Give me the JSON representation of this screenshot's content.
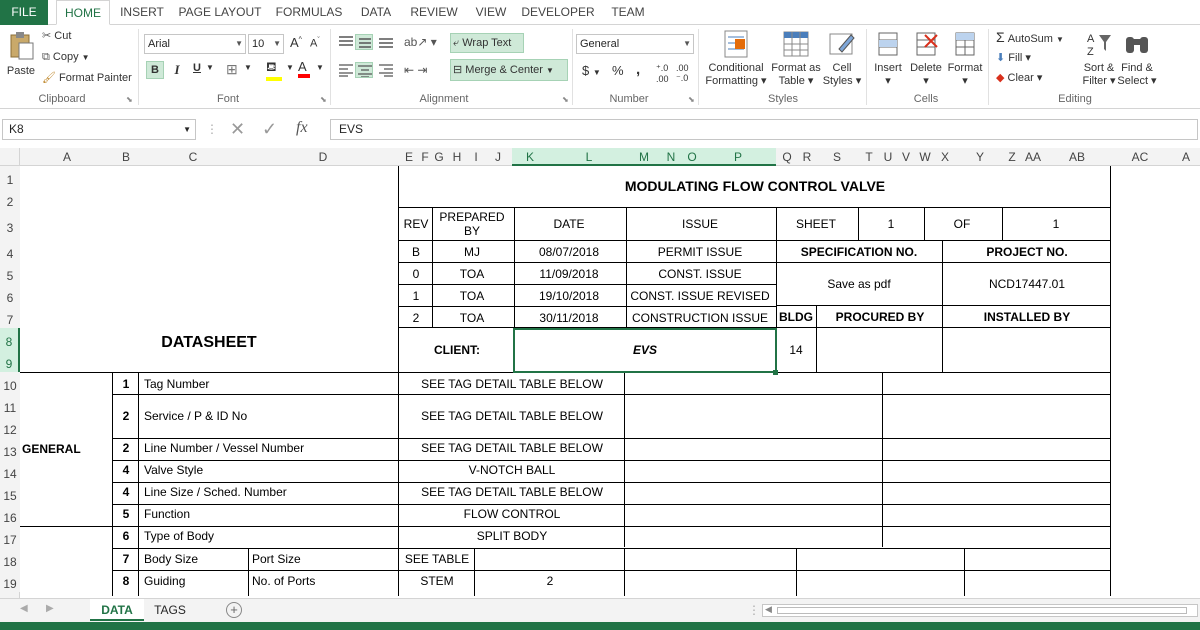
{
  "ribbon_tabs": [
    "FILE",
    "HOME",
    "INSERT",
    "PAGE LAYOUT",
    "FORMULAS",
    "DATA",
    "REVIEW",
    "VIEW",
    "DEVELOPER",
    "TEAM"
  ],
  "clipboard": {
    "paste": "Paste",
    "cut": "Cut",
    "copy": "Copy",
    "format_painter": "Format Painter",
    "group": "Clipboard"
  },
  "font": {
    "name": "Arial",
    "size": "10",
    "bold": "B",
    "italic": "I",
    "underline": "U",
    "group": "Font"
  },
  "alignment": {
    "wrap_text": "Wrap Text",
    "merge_center": "Merge & Center",
    "group": "Alignment"
  },
  "number": {
    "format": "General",
    "currency": "$",
    "percent": "%",
    "comma": ",",
    "group": "Number"
  },
  "styles": {
    "conditional": "Conditional",
    "conditional2": "Formatting",
    "format_as": "Format as",
    "table": "Table",
    "cell": "Cell",
    "cell_styles": "Styles",
    "group": "Styles"
  },
  "cells": {
    "insert": "Insert",
    "delete": "Delete",
    "format": "Format",
    "group": "Cells"
  },
  "editing": {
    "autosum": "AutoSum",
    "fill": "Fill",
    "clear": "Clear",
    "sort": "Sort &",
    "filter": "Filter",
    "find": "Find &",
    "select": "Select",
    "group": "Editing"
  },
  "formula_bar": {
    "name_box": "K8",
    "fx": "fx",
    "value": "EVS"
  },
  "columns": [
    "A",
    "B",
    "C",
    "D",
    "E",
    "F",
    "G",
    "H",
    "I",
    "J",
    "K",
    "L",
    "M",
    "N",
    "O",
    "P",
    "Q",
    "R",
    "S",
    "T",
    "U",
    "V",
    "W",
    "X",
    "Y",
    "Z",
    "AA",
    "AB",
    "AC",
    "A"
  ],
  "rows": [
    "1",
    "2",
    "3",
    "4",
    "5",
    "6",
    "7",
    "8",
    "9",
    "10",
    "11",
    "12",
    "13",
    "14",
    "15",
    "16",
    "17",
    "18",
    "19"
  ],
  "sheet": {
    "title": "MODULATING FLOW CONTROL VALVE",
    "datasheet": "DATASHEET",
    "rev_header": "REV",
    "prepared_header": "PREPARED BY",
    "date_header": "DATE",
    "issue_header": "ISSUE",
    "sheet_label": "SHEET",
    "sheet_no": "1",
    "of_label": "OF",
    "of_no": "1",
    "spec_label": "SPECIFICATION NO.",
    "project_label": "PROJECT NO.",
    "spec_value": "Save as pdf",
    "project_value": "NCD17447.01",
    "bldg_label": "BLDG",
    "procured_label": "PROCURED BY",
    "installed_label": "INSTALLED BY",
    "client_label": "CLIENT:",
    "client_value": "EVS",
    "bldg_value": "14",
    "revisions": [
      {
        "rev": "B",
        "by": "MJ",
        "date": "08/07/2018",
        "issue": "PERMIT ISSUE"
      },
      {
        "rev": "0",
        "by": "TOA",
        "date": "11/09/2018",
        "issue": "CONST. ISSUE"
      },
      {
        "rev": "1",
        "by": "TOA",
        "date": "19/10/2018",
        "issue": "CONST. ISSUE REVISED"
      },
      {
        "rev": "2",
        "by": "TOA",
        "date": "30/11/2018",
        "issue": "CONSTRUCTION ISSUE"
      }
    ],
    "general_label": "GENERAL",
    "items": [
      {
        "no": "1",
        "label": "Tag Number",
        "value": "SEE TAG DETAIL TABLE BELOW"
      },
      {
        "no": "2",
        "label": "Service / P & ID No",
        "value": "SEE TAG DETAIL TABLE BELOW"
      },
      {
        "no": "2",
        "label": "Line Number / Vessel Number",
        "value": "SEE TAG DETAIL TABLE BELOW"
      },
      {
        "no": "4",
        "label": "Valve Style",
        "value": "V-NOTCH BALL"
      },
      {
        "no": "4",
        "label": "Line Size / Sched. Number",
        "value": "SEE TAG DETAIL TABLE BELOW"
      },
      {
        "no": "5",
        "label": "Function",
        "value": "FLOW CONTROL"
      },
      {
        "no": "6",
        "label": "Type of Body",
        "value": "SPLIT BODY"
      }
    ],
    "row18": {
      "no": "7",
      "label": "Body Size",
      "sub": "Port Size",
      "value": "SEE TABLE"
    },
    "row19": {
      "no": "8",
      "label": "Guiding",
      "sub": "No. of Ports",
      "value": "STEM",
      "value2": "2"
    }
  },
  "sheet_tabs": [
    "DATA",
    "TAGS"
  ],
  "add_sheet": "+",
  "colors": {
    "excel_green": "#217346",
    "selection": "#d3f0e0"
  }
}
